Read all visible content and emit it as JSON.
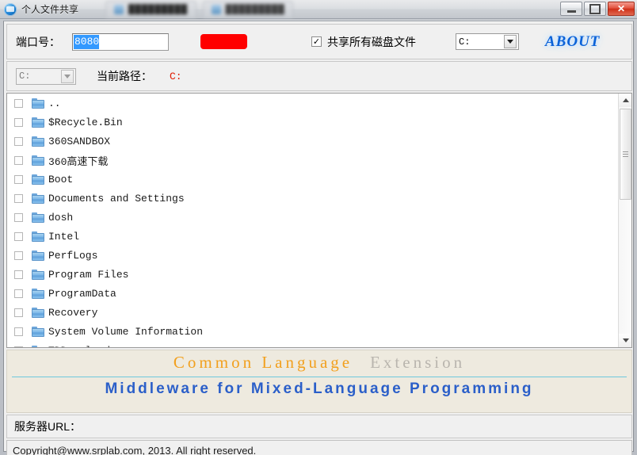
{
  "window": {
    "title": "个人文件共享",
    "app_icon": "app-globe-icon",
    "ghost_tabs": [
      {
        "label": "█████████",
        "icon": "tab-icon"
      },
      {
        "label": "█████████",
        "icon": "tab-icon"
      }
    ],
    "controls": {
      "minimize": "minimize-icon",
      "maximize": "maximize-icon",
      "close": "✕"
    }
  },
  "toolbar": {
    "port_label": "端口号：",
    "port_value": "8080",
    "redacted_button": "",
    "share_all_label": "共享所有磁盘文件",
    "share_all_checked": true,
    "check_glyph": "✓",
    "drive_select_value": "C:",
    "about_label": "ABOUT"
  },
  "pathbar": {
    "drive_select_value": "C:",
    "current_path_label": "当前路径：",
    "current_path_value": "C:"
  },
  "filelist": {
    "items": [
      {
        "name": "..",
        "checked": false
      },
      {
        "name": "$Recycle.Bin",
        "checked": false
      },
      {
        "name": "360SANDBOX",
        "checked": false
      },
      {
        "name": "360高速下载",
        "checked": false
      },
      {
        "name": "Boot",
        "checked": false
      },
      {
        "name": "Documents and Settings",
        "checked": false
      },
      {
        "name": "dosh",
        "checked": false
      },
      {
        "name": "Intel",
        "checked": false
      },
      {
        "name": "PerfLogs",
        "checked": false
      },
      {
        "name": "Program Files",
        "checked": false
      },
      {
        "name": "ProgramData",
        "checked": false
      },
      {
        "name": "Recovery",
        "checked": false
      },
      {
        "name": "System Volume Information",
        "checked": false
      },
      {
        "name": "TDDownload",
        "checked": false
      }
    ]
  },
  "banner": {
    "line1_primary": "Common Language",
    "line1_secondary": "Extension",
    "line2": "Middleware for Mixed-Language Programming",
    "colors": {
      "primary": "#f2a01e",
      "secondary": "#b9b5ae",
      "line2": "#2b5fc9",
      "rule": "#6ec8dd",
      "background": "#eeeadf"
    }
  },
  "server_url": {
    "label": "服务器URL：",
    "value": ""
  },
  "status": {
    "copyright": "Copyright@www.srplab.com, 2013.  All right reserved."
  }
}
